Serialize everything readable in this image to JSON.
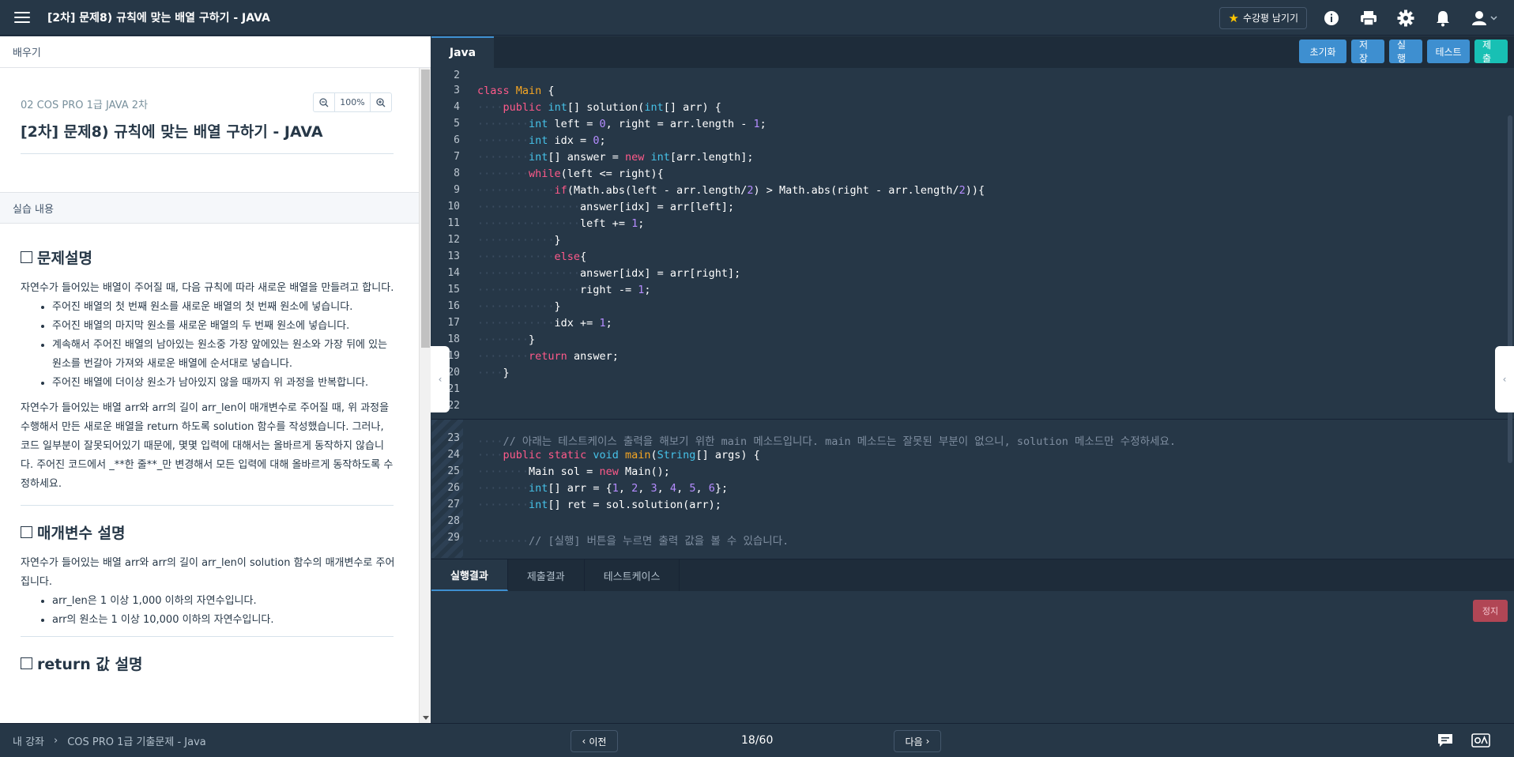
{
  "header": {
    "title": "[2차] 문제8) 규칙에 맞는 배열 구하기 - JAVA",
    "review_button": "수강평 남기기",
    "icons": [
      "info-icon",
      "print-icon",
      "gear-icon",
      "bell-icon",
      "user-icon"
    ]
  },
  "left": {
    "head": "배우기",
    "course": "02 COS PRO 1급 JAVA 2차",
    "zoom": "100%",
    "title": "[2차] 문제8) 규칙에 맞는 배열 구하기 - JAVA",
    "practice_head": "실습 내용",
    "sec1_title": "문제설명",
    "sec1_intro": "자연수가 들어있는 배열이 주어질 때, 다음 규칙에 따라 새로운 배열을 만들려고 합니다.",
    "sec1_bullets": [
      "주어진 배열의 첫 번째 원소를 새로운 배열의 첫 번째 원소에 넣습니다.",
      "주어진 배열의 마지막 원소를 새로운 배열의 두 번째 원소에 넣습니다.",
      "계속해서 주어진 배열의 남아있는 원소중 가장 앞에있는 원소와 가장 뒤에 있는 원소를 번갈아 가져와 새로운 배열에 순서대로 넣습니다.",
      "주어진 배열에 더이상 원소가 남아있지 않을 때까지 위 과정을 반복합니다."
    ],
    "sec1_body": "자연수가 들어있는 배열 arr와 arr의 길이 arr_len이 매개변수로 주어질 때, 위 과정을 수행해서 만든 새로운 배열을 return 하도록 solution 함수를 작성했습니다. 그러나, 코드 일부분이 잘못되어있기 때문에, 몇몇 입력에 대해서는 올바르게 동작하지 않습니다. 주어진 코드에서 _**한 줄**_만 변경해서 모든 입력에 대해 올바르게 동작하도록 수정하세요.",
    "sec2_title": "매개변수 설명",
    "sec2_intro": "자연수가 들어있는 배열 arr와 arr의 길이 arr_len이 solution 함수의 매개변수로 주어집니다.",
    "sec2_bullets": [
      "arr_len은 1 이상 1,000 이하의 자연수입니다.",
      "arr의 원소는 1 이상 10,000 이하의 자연수입니다."
    ],
    "sec3_title": "return 값 설명"
  },
  "editor": {
    "tab": "Java",
    "buttons": [
      "초기화",
      "저장",
      "실행",
      "테스트",
      "제출"
    ],
    "line_numbers": [
      "2",
      "3",
      "4",
      "5",
      "6",
      "7",
      "8",
      "9",
      "10",
      "11",
      "12",
      "13",
      "14",
      "15",
      "16",
      "17",
      "18",
      "19",
      "20",
      "21",
      "22",
      "23",
      "24",
      "25",
      "26",
      "27",
      "28",
      "29"
    ],
    "code": {
      "l3_kw": "class",
      "l3_cls": "Main",
      "l3_rest": " {",
      "l4_kw": "public",
      "l4_ty": "int",
      "l4_a": "[] solution(",
      "l4_ty2": "int",
      "l4_b": "[] arr) {",
      "l5_ty": "int",
      "l5_a": " left = ",
      "l5_n1": "0",
      "l5_b": ", right = arr.length - ",
      "l5_n2": "1",
      "l5_c": ";",
      "l6_ty": "int",
      "l6_a": " idx = ",
      "l6_n": "0",
      "l6_b": ";",
      "l7_ty": "int",
      "l7_a": "[] answer = ",
      "l7_kw": "new",
      "l7_ty2": "int",
      "l7_b": "[arr.length];",
      "l8_kw": "while",
      "l8_a": "(left <= right){",
      "l9_kw": "if",
      "l9_a": "(Math.abs(left - arr.length/",
      "l9_n1": "2",
      "l9_b": ") > Math.abs(right - arr.length/",
      "l9_n2": "2",
      "l9_c": ")){",
      "l10": "answer[idx] = arr[left];",
      "l11_a": "left += ",
      "l11_n": "1",
      "l11_b": ";",
      "l12": "}",
      "l13_kw": "else",
      "l13_a": "{",
      "l14": "answer[idx] = arr[right];",
      "l15_a": "right -= ",
      "l15_n": "1",
      "l15_b": ";",
      "l16": "}",
      "l17_a": "idx += ",
      "l17_n": "1",
      "l17_b": ";",
      "l18": "}",
      "l19_kw": "return",
      "l19_a": " answer;",
      "l20": "}",
      "l23": "// 아래는 테스트케이스 출력을 해보기 위한 main 메소드입니다. main 메소드는 잘못된 부분이 없으니, solution 메소드만 수정하세요.",
      "l24_kw1": "public",
      "l24_kw2": "static",
      "l24_kw3": "void",
      "l24_cls": "main",
      "l24_a": "(",
      "l24_cls2": "String",
      "l24_b": "[] args) {",
      "l25_cls": "Main",
      "l25_a": " sol = ",
      "l25_kw": "new",
      "l25_cls2": " Main",
      "l25_b": "();",
      "l26_ty": "int",
      "l26_a": "[] arr = {",
      "l26_n": [
        "1",
        "2",
        "3",
        "4",
        "5",
        "6"
      ],
      "l26_b": "};",
      "l27_ty": "int",
      "l27_a": "[] ret = sol.solution(arr);",
      "l29": "// [실행] 버튼을 누르면 출력 값을 볼 수 있습니다."
    }
  },
  "output": {
    "tabs": [
      "실행결과",
      "제출결과",
      "테스트케이스"
    ],
    "stop": "정지"
  },
  "footer": {
    "crumb1": "내 강좌",
    "crumb2": "COS PRO 1급 기출문제 - Java",
    "prev": "이전",
    "pager": "18/60",
    "next": "다음"
  }
}
